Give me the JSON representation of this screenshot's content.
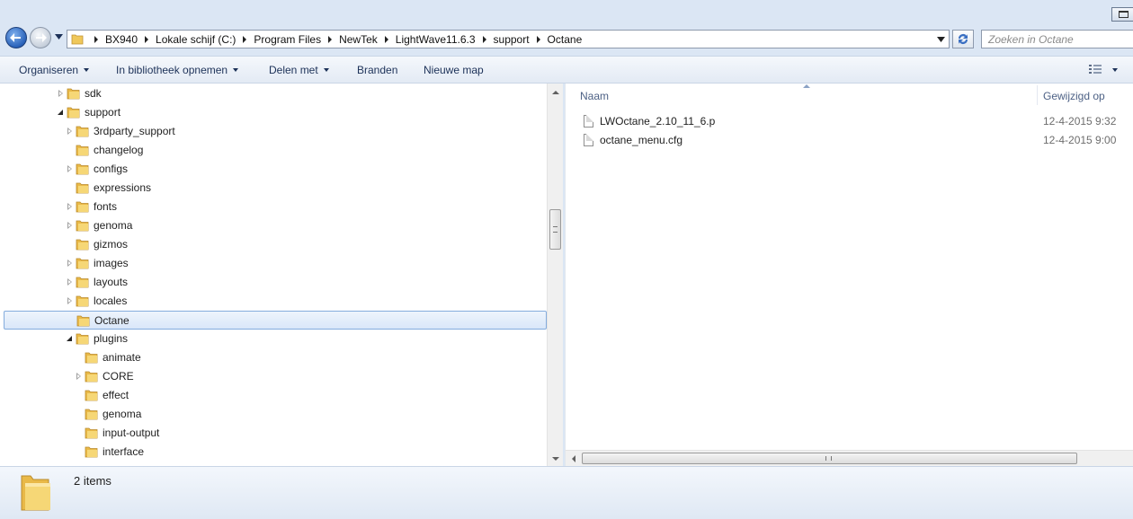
{
  "address_bar": {
    "breadcrumbs": [
      "BX940",
      "Lokale schijf (C:)",
      "Program Files",
      "NewTek",
      "LightWave11.6.3",
      "support",
      "Octane"
    ]
  },
  "search": {
    "placeholder": "Zoeken in Octane"
  },
  "toolbar": {
    "organize_label": "Organiseren",
    "include_library_label": "In bibliotheek opnemen",
    "share_label": "Delen met",
    "burn_label": "Branden",
    "new_folder_label": "Nieuwe map"
  },
  "nav_tree": [
    {
      "label": "sdk",
      "expander": "closed",
      "depth": 0
    },
    {
      "label": "support",
      "expander": "open",
      "depth": 0
    },
    {
      "label": "3rdparty_support",
      "expander": "closed",
      "depth": 1
    },
    {
      "label": "changelog",
      "expander": "none",
      "depth": 1
    },
    {
      "label": "configs",
      "expander": "closed",
      "depth": 1
    },
    {
      "label": "expressions",
      "expander": "none",
      "depth": 1
    },
    {
      "label": "fonts",
      "expander": "closed",
      "depth": 1
    },
    {
      "label": "genoma",
      "expander": "closed",
      "depth": 1
    },
    {
      "label": "gizmos",
      "expander": "none",
      "depth": 1
    },
    {
      "label": "images",
      "expander": "closed",
      "depth": 1
    },
    {
      "label": "layouts",
      "expander": "closed",
      "depth": 1
    },
    {
      "label": "locales",
      "expander": "closed",
      "depth": 1
    },
    {
      "label": "Octane",
      "expander": "none",
      "depth": 1,
      "selected": true
    },
    {
      "label": "plugins",
      "expander": "open",
      "depth": 1
    },
    {
      "label": "animate",
      "expander": "none",
      "depth": 2
    },
    {
      "label": "CORE",
      "expander": "closed",
      "depth": 2
    },
    {
      "label": "effect",
      "expander": "none",
      "depth": 2
    },
    {
      "label": "genoma",
      "expander": "none",
      "depth": 2
    },
    {
      "label": "input-output",
      "expander": "none",
      "depth": 2
    },
    {
      "label": "interface",
      "expander": "none",
      "depth": 2
    }
  ],
  "file_list": {
    "columns": {
      "name": "Naam",
      "modified": "Gewijzigd op"
    },
    "rows": [
      {
        "name": "LWOctane_2.10_11_6.p",
        "modified": "12-4-2015 9:32"
      },
      {
        "name": "octane_menu.cfg",
        "modified": "12-4-2015 9:00"
      }
    ]
  },
  "details": {
    "item_count": "2 items"
  },
  "colors": {
    "accent": "#2a62b9",
    "folder": "#f0c85a",
    "selection": "#d9e7f9"
  }
}
